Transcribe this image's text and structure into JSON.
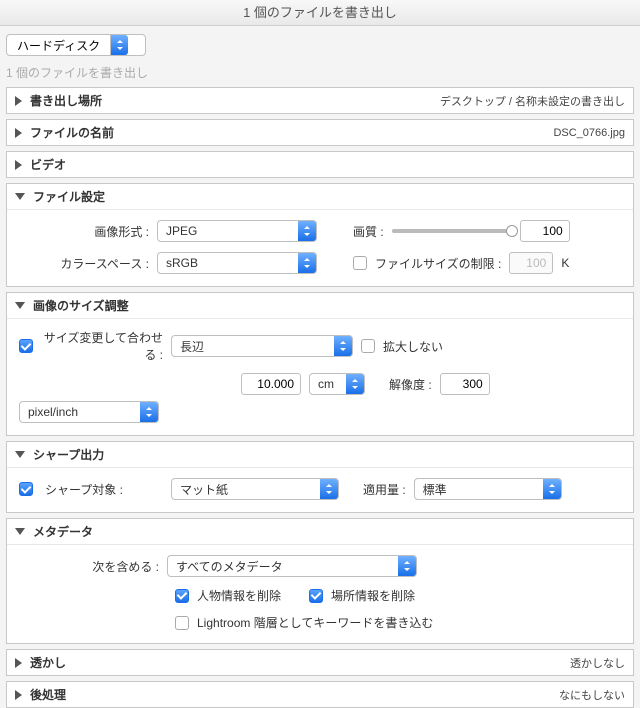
{
  "window": {
    "title": "1 個のファイルを書き出し"
  },
  "destination": {
    "selected": "ハードディスク"
  },
  "count_caption": "1 個のファイルを書き出し",
  "location": {
    "title": "書き出し場所",
    "summary": "デスクトップ / 名称未設定の書き出し"
  },
  "filename": {
    "title": "ファイルの名前",
    "summary": "DSC_0766.jpg"
  },
  "video": {
    "title": "ビデオ"
  },
  "filesettings": {
    "title": "ファイル設定",
    "format_label": "画像形式 :",
    "format_value": "JPEG",
    "quality_label": "画質 :",
    "quality_value": "100",
    "colorspace_label": "カラースペース :",
    "colorspace_value": "sRGB",
    "limit_label": "ファイルサイズの制限 :",
    "limit_value": "100",
    "limit_unit": "K"
  },
  "sizing": {
    "title": "画像のサイズ調整",
    "fit_label": "サイズ変更して合わせる :",
    "fit_value": "長辺",
    "dont_enlarge": "拡大しない",
    "size_value": "10.000",
    "size_unit": "cm",
    "resolution_label": "解像度 :",
    "resolution_value": "300",
    "resolution_unit": "pixel/inch"
  },
  "sharpen": {
    "title": "シャープ出力",
    "for_label": "シャープ対象 :",
    "for_value": "マット紙",
    "amount_label": "適用量 :",
    "amount_value": "標準"
  },
  "metadata": {
    "title": "メタデータ",
    "include_label": "次を含める :",
    "include_value": "すべてのメタデータ",
    "remove_person": "人物情報を削除",
    "remove_location": "場所情報を削除",
    "lr_hierarchy": "Lightroom 階層としてキーワードを書き込む"
  },
  "watermark": {
    "title": "透かし",
    "summary": "透かしなし"
  },
  "postprocess": {
    "title": "後処理",
    "summary": "なにもしない"
  }
}
